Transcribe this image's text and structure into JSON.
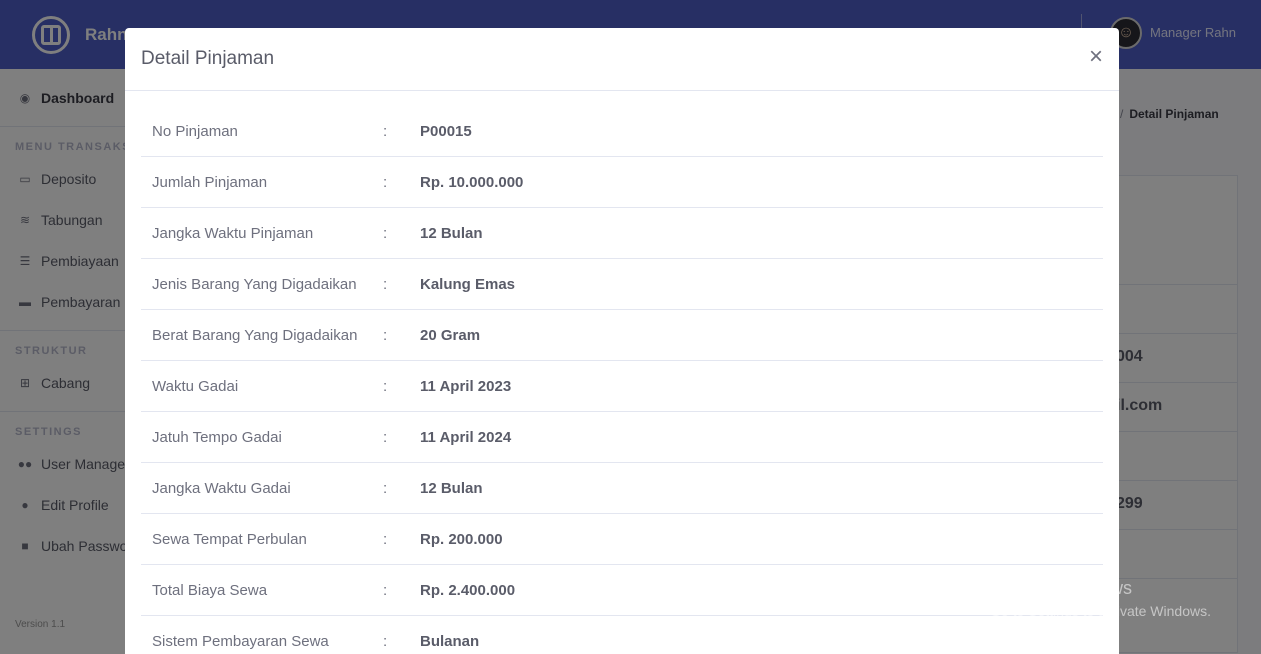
{
  "brand": {
    "name": "Rahn"
  },
  "topbar": {
    "user_name": "Manager Rahn"
  },
  "sidebar": {
    "dashboard": "Dashboard",
    "heading_transaksi": "MENU TRANSAKSI",
    "items_transaksi": [
      "Deposito",
      "Tabungan",
      "Pembiayaan",
      "Pembayaran"
    ],
    "heading_struktur": "STRUKTUR",
    "items_struktur": [
      "Cabang"
    ],
    "heading_settings": "SETTINGS",
    "items_settings": [
      "User Management",
      "Edit Profile",
      "Ubah Password"
    ],
    "version": "Version 1.1"
  },
  "breadcrumb": {
    "current": "Detail Pinjaman"
  },
  "background_card": {
    "values": [
      "004",
      "il.com",
      "299"
    ]
  },
  "modal": {
    "title": "Detail Pinjaman",
    "close": "×",
    "rows": [
      {
        "label": "No Pinjaman",
        "value": "P00015"
      },
      {
        "label": "Jumlah Pinjaman",
        "value": "Rp. 10.000.000"
      },
      {
        "label": "Jangka Waktu Pinjaman",
        "value": "12 Bulan"
      },
      {
        "label": "Jenis Barang Yang Digadaikan",
        "value": "Kalung Emas"
      },
      {
        "label": "Berat Barang Yang Digadaikan",
        "value": "20 Gram"
      },
      {
        "label": "Waktu Gadai",
        "value": "11 April 2023"
      },
      {
        "label": "Jatuh Tempo Gadai",
        "value": "11 April 2024"
      },
      {
        "label": "Jangka Waktu Gadai",
        "value": "12 Bulan"
      },
      {
        "label": "Sewa Tempat Perbulan",
        "value": "Rp. 200.000"
      },
      {
        "label": "Total Biaya Sewa",
        "value": "Rp. 2.400.000"
      },
      {
        "label": "Sistem Pembayaran Sewa",
        "value": "Bulanan"
      }
    ]
  },
  "watermark": {
    "line1": "Activate Windows",
    "line2": "Go to Settings to activate Windows."
  }
}
